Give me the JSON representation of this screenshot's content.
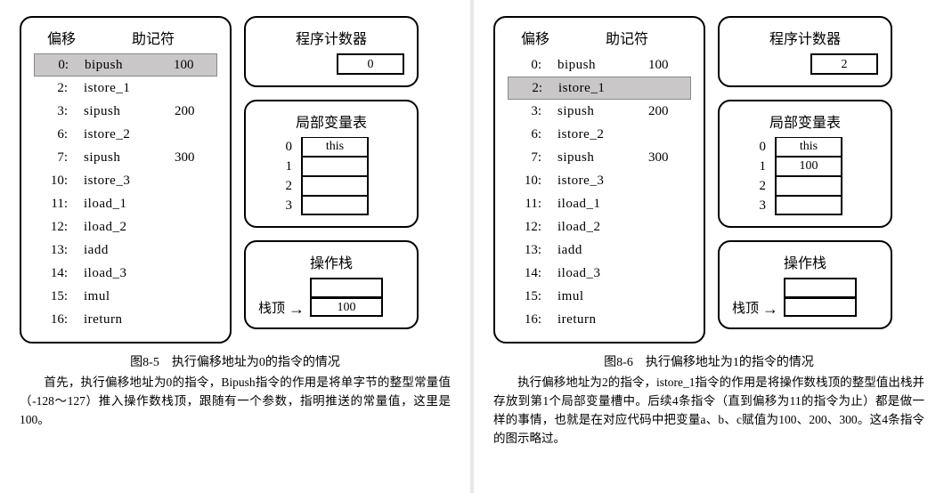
{
  "left": {
    "code": {
      "header_offset": "偏移",
      "header_mnemonic": "助记符",
      "rows": [
        {
          "offset": "0:",
          "mnemonic": "bipush",
          "arg": "100",
          "highlight": true
        },
        {
          "offset": "2:",
          "mnemonic": "istore_1",
          "arg": "",
          "highlight": false
        },
        {
          "offset": "3:",
          "mnemonic": "sipush",
          "arg": "200",
          "highlight": false
        },
        {
          "offset": "6:",
          "mnemonic": "istore_2",
          "arg": "",
          "highlight": false
        },
        {
          "offset": "7:",
          "mnemonic": "sipush",
          "arg": "300",
          "highlight": false
        },
        {
          "offset": "10:",
          "mnemonic": "istore_3",
          "arg": "",
          "highlight": false
        },
        {
          "offset": "11:",
          "mnemonic": "iload_1",
          "arg": "",
          "highlight": false
        },
        {
          "offset": "12:",
          "mnemonic": "iload_2",
          "arg": "",
          "highlight": false
        },
        {
          "offset": "13:",
          "mnemonic": "iadd",
          "arg": "",
          "highlight": false
        },
        {
          "offset": "14:",
          "mnemonic": "iload_3",
          "arg": "",
          "highlight": false
        },
        {
          "offset": "15:",
          "mnemonic": "imul",
          "arg": "",
          "highlight": false
        },
        {
          "offset": "16:",
          "mnemonic": "ireturn",
          "arg": "",
          "highlight": false
        }
      ]
    },
    "pc": {
      "title": "程序计数器",
      "value": "0"
    },
    "locals": {
      "title": "局部变量表",
      "rows": [
        {
          "idx": "0",
          "value": "this"
        },
        {
          "idx": "1",
          "value": ""
        },
        {
          "idx": "2",
          "value": ""
        },
        {
          "idx": "3",
          "value": ""
        }
      ]
    },
    "stack": {
      "title": "操作栈",
      "top_label": "栈顶",
      "cells": [
        {
          "value": ""
        },
        {
          "value": "100"
        }
      ]
    },
    "caption": "图8-5　执行偏移地址为0的指令的情况",
    "paragraph": "　　首先，执行偏移地址为0的指令，Bipush指令的作用是将单字节的整型常量值（-128～127）推入操作数栈顶，跟随有一个参数，指明推送的常量值，这里是100。"
  },
  "right": {
    "code": {
      "header_offset": "偏移",
      "header_mnemonic": "助记符",
      "rows": [
        {
          "offset": "0:",
          "mnemonic": "bipush",
          "arg": "100",
          "highlight": false
        },
        {
          "offset": "2:",
          "mnemonic": "istore_1",
          "arg": "",
          "highlight": true
        },
        {
          "offset": "3:",
          "mnemonic": "sipush",
          "arg": "200",
          "highlight": false
        },
        {
          "offset": "6:",
          "mnemonic": "istore_2",
          "arg": "",
          "highlight": false
        },
        {
          "offset": "7:",
          "mnemonic": "sipush",
          "arg": "300",
          "highlight": false
        },
        {
          "offset": "10:",
          "mnemonic": "istore_3",
          "arg": "",
          "highlight": false
        },
        {
          "offset": "11:",
          "mnemonic": "iload_1",
          "arg": "",
          "highlight": false
        },
        {
          "offset": "12:",
          "mnemonic": "iload_2",
          "arg": "",
          "highlight": false
        },
        {
          "offset": "13:",
          "mnemonic": "iadd",
          "arg": "",
          "highlight": false
        },
        {
          "offset": "14:",
          "mnemonic": "iload_3",
          "arg": "",
          "highlight": false
        },
        {
          "offset": "15:",
          "mnemonic": "imul",
          "arg": "",
          "highlight": false
        },
        {
          "offset": "16:",
          "mnemonic": "ireturn",
          "arg": "",
          "highlight": false
        }
      ]
    },
    "pc": {
      "title": "程序计数器",
      "value": "2"
    },
    "locals": {
      "title": "局部变量表",
      "rows": [
        {
          "idx": "0",
          "value": "this"
        },
        {
          "idx": "1",
          "value": "100"
        },
        {
          "idx": "2",
          "value": ""
        },
        {
          "idx": "3",
          "value": ""
        }
      ]
    },
    "stack": {
      "title": "操作栈",
      "top_label": "栈顶",
      "cells": [
        {
          "value": ""
        },
        {
          "value": ""
        }
      ]
    },
    "caption": "图8-6　执行偏移地址为1的指令的情况",
    "paragraph": "　　执行偏移地址为2的指令，istore_1指令的作用是将操作数栈顶的整型值出栈并存放到第1个局部变量槽中。后续4条指令（直到偏移为11的指令为止）都是做一样的事情，也就是在对应代码中把变量a、b、c赋值为100、200、300。这4条指令的图示略过。"
  }
}
